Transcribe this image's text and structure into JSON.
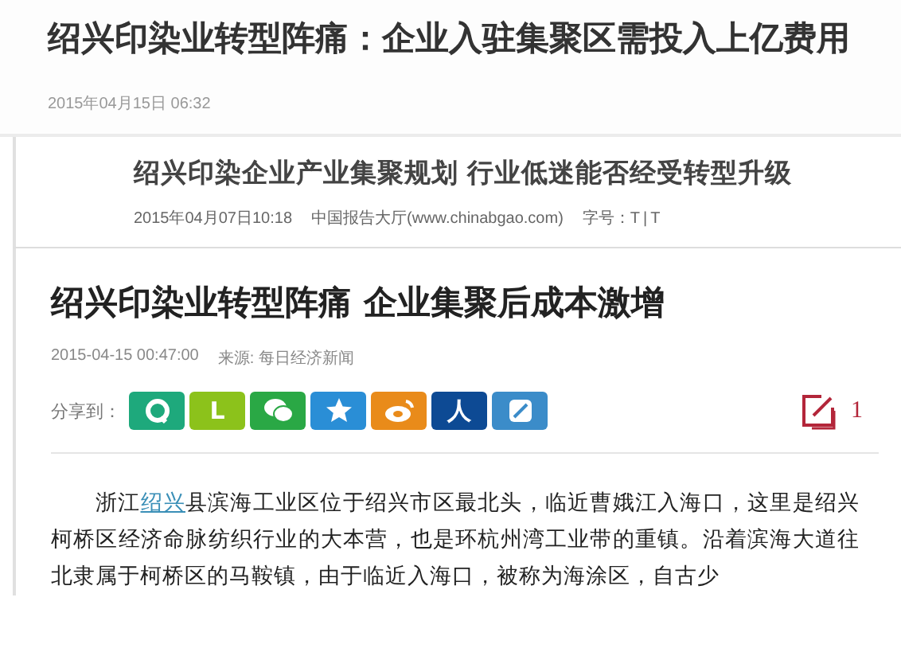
{
  "article_1": {
    "title": "绍兴印染业转型阵痛：企业入驻集聚区需投入上亿费用",
    "date": "2015年04月15日  06:32"
  },
  "article_2": {
    "title": "绍兴印染企业产业集聚规划 行业低迷能否经受转型升级",
    "date": "2015年04月07日10:18",
    "source": "中国报告大厅(www.chinabgao.com)",
    "font_label": "字号：",
    "font_options": [
      "T",
      "T"
    ],
    "font_separator": "|"
  },
  "article_3": {
    "title": "绍兴印染业转型阵痛  企业集聚后成本激增",
    "date": "2015-04-15 00:47:00",
    "source": "来源: 每日经济新闻",
    "share_label": "分享到：",
    "share_buttons": [
      {
        "kind": "qzone",
        "color": "#1ea97c"
      },
      {
        "kind": "letter",
        "label": "L",
        "color": "#8cc21b"
      },
      {
        "kind": "wechat",
        "color": "#2aa845"
      },
      {
        "kind": "star",
        "color": "#2a8ed6"
      },
      {
        "kind": "weibo",
        "color": "#e98b1a"
      },
      {
        "kind": "letter",
        "label": "人",
        "color": "#0d4a94"
      },
      {
        "kind": "note",
        "color": "#3b8cc9"
      }
    ],
    "comment_count": "1",
    "paragraph": {
      "before": "浙江",
      "link": "绍兴",
      "after": "县滨海工业区位于绍兴市区最北头，临近曹娥江入海口，这里是绍兴柯桥区经济命脉纺织行业的大本营，也是环杭州湾工业带的重镇。沿着滨海大道往北隶属于柯桥区的马鞍镇，由于临近入海口，被称为海涂区，自古少"
    }
  }
}
